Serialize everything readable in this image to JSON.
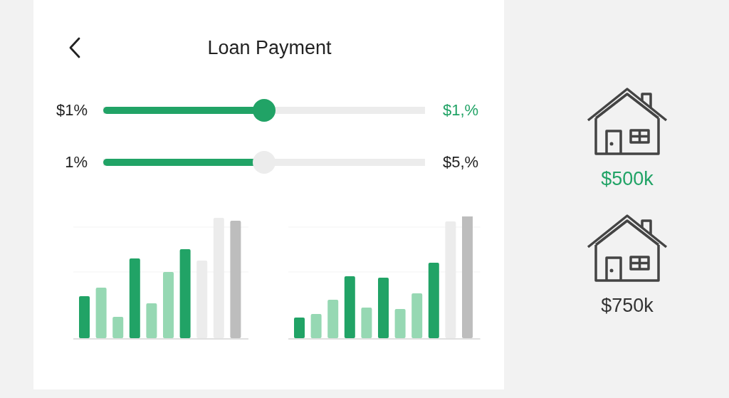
{
  "screen": {
    "title": "Loan Payment"
  },
  "sliders": [
    {
      "label": "$1%",
      "level": 0.5,
      "focused": true,
      "value": "$1,%"
    },
    {
      "label": "1%",
      "level": 0.5,
      "focused": false,
      "value": "$5,%"
    }
  ],
  "houses": [
    {
      "price": "$500k",
      "selected": true
    },
    {
      "price": "$750k",
      "selected": false
    }
  ]
}
